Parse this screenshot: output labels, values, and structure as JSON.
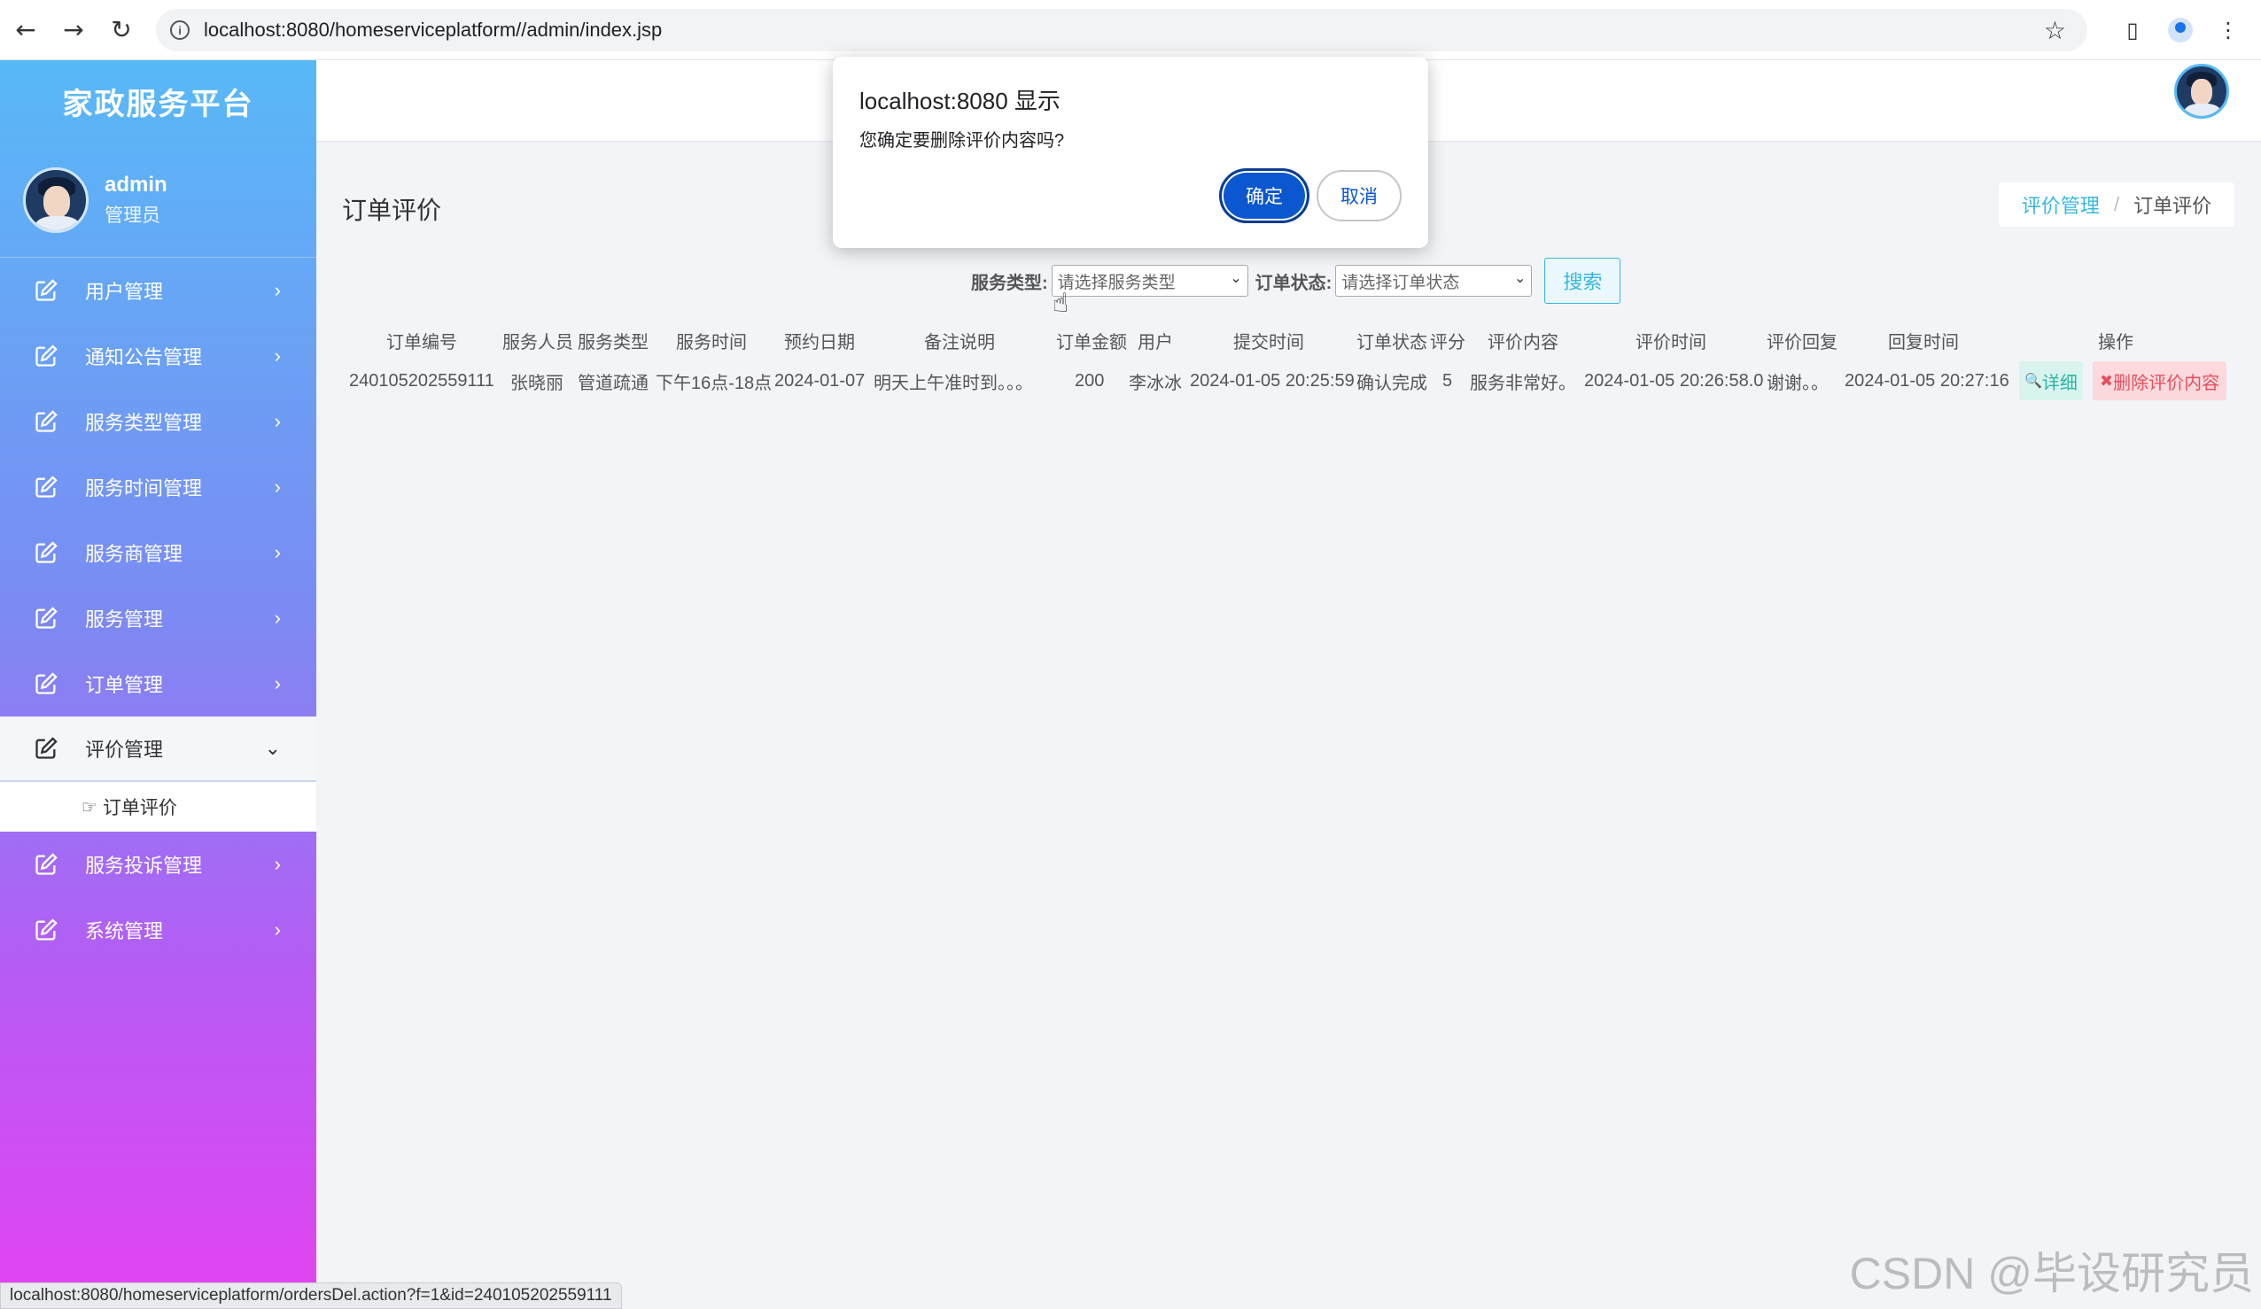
{
  "browser": {
    "url": "localhost:8080/homeserviceplatform//admin/index.jsp",
    "back_icon": "←",
    "forward_icon": "→",
    "reload_icon": "↻",
    "star_icon": "☆",
    "sidepanel_icon": "▯"
  },
  "sidebar": {
    "brand": "家政服务平台",
    "user_name": "admin",
    "user_role": "管理员",
    "items": [
      {
        "label": "用户管理",
        "chev": "›"
      },
      {
        "label": "通知公告管理",
        "chev": "›"
      },
      {
        "label": "服务类型管理",
        "chev": "›"
      },
      {
        "label": "服务时间管理",
        "chev": "›"
      },
      {
        "label": "服务商管理",
        "chev": "›"
      },
      {
        "label": "服务管理",
        "chev": "›"
      },
      {
        "label": "订单管理",
        "chev": "›"
      },
      {
        "label": "评价管理",
        "chev": "⌄"
      },
      {
        "label": "服务投诉管理",
        "chev": "›"
      },
      {
        "label": "系统管理",
        "chev": "›"
      }
    ],
    "submenu": {
      "hand": "☞",
      "label": "订单评价"
    }
  },
  "page": {
    "title": "订单评价",
    "breadcrumb": {
      "parent": "评价管理",
      "sep": "/",
      "current": "订单评价"
    }
  },
  "search": {
    "service_type_label": "服务类型:",
    "service_type_placeholder": "请选择服务类型",
    "order_status_label": "订单状态:",
    "order_status_placeholder": "请选择订单状态",
    "arrow": "⌄",
    "button": "搜索"
  },
  "table": {
    "headers": [
      "订单编号",
      "服务人员",
      "服务类型",
      "服务时间",
      "预约日期",
      "备注说明",
      "订单金额",
      "用户",
      "提交时间",
      "订单状态",
      "评分",
      "评价内容",
      "评价时间",
      "评价回复",
      "回复时间",
      "操作"
    ],
    "rows": [
      {
        "order_no": "240105202559111",
        "staff": "张晓丽",
        "service_type": "管道疏通",
        "service_time": "下午16点-18点",
        "appoint_date": "2024-01-07",
        "remark": "明天上午准时到。。。",
        "amount": "200",
        "user": "李冰冰",
        "submit_time": "2024-01-05 20:25:59",
        "status": "确认完成",
        "score": "5",
        "content": "服务非常好。",
        "eval_time": "2024-01-05 20:26:58.0",
        "reply": "谢谢。。",
        "reply_time": "2024-01-05 20:27:16",
        "detail_btn": "详细",
        "detail_icon": "🔍",
        "delete_btn": "删除评价内容",
        "delete_icon": "✖"
      }
    ]
  },
  "dialog": {
    "title": "localhost:8080 显示",
    "message": "您确定要删除评价内容吗?",
    "ok": "确定",
    "cancel": "取消"
  },
  "statusbar": "localhost:8080/homeserviceplatform/ordersDel.action?f=1&id=240105202559111",
  "watermark": "CSDN @毕设研究员"
}
